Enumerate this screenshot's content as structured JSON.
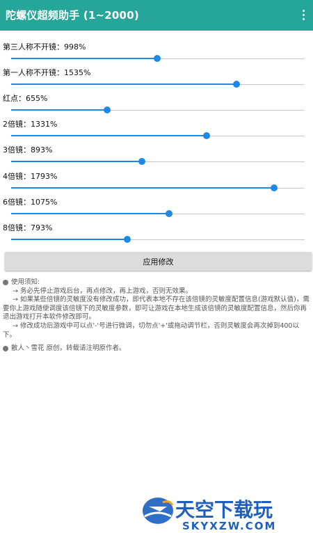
{
  "app": {
    "title": "陀螺仪超频助手 (1~2000)"
  },
  "slider_range": {
    "min": 1,
    "max": 2000
  },
  "accent_color": "#1e88e5",
  "toolbar_color": "#26a69a",
  "settings": [
    {
      "label": "第三人称不开镜：998%",
      "value": 998
    },
    {
      "label": "第一人称不开镜：1535%",
      "value": 1535
    },
    {
      "label": "红点：655%",
      "value": 655
    },
    {
      "label": "2倍镜：1331%",
      "value": 1331
    },
    {
      "label": "3倍镜：893%",
      "value": 893
    },
    {
      "label": "4倍镜：1793%",
      "value": 1793
    },
    {
      "label": "6倍镜：1075%",
      "value": 1075
    },
    {
      "label": "8倍镜：793%",
      "value": 793
    }
  ],
  "apply_button": {
    "label": "应用修改"
  },
  "notes": {
    "heading": "使用须知:",
    "items": [
      "→ 务必先停止游戏后台，再点修改，再上游戏，否则无效果。",
      "→ 如果某些倍镜的灵敏度没有修改成功，即代表本地不存在该倍镜的灵敏度配置信息(游戏默认值)，需要你上游戏随便调度该倍镜下的灵敏度参数，即可让游戏在本地生成该倍镜的灵敏度配置信息，然后你再退出游戏打开本软件修改即可。",
      "→ 修改成功后游戏中可以点'-'号进行微调，切勿点'+'或拖动调节栏，否则灵敏度会再次掉到400以下。"
    ],
    "credit": "散人丶雪花 原创，转载请注明原作者。"
  },
  "watermark": {
    "name": "天空下载玩",
    "domain": "SKYXZW.COM"
  }
}
